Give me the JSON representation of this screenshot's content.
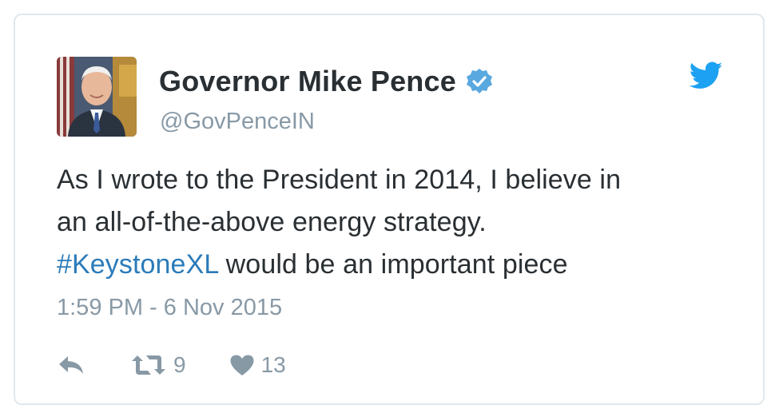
{
  "tweet": {
    "author": {
      "display_name": "Governor Mike Pence",
      "handle": "@GovPenceIN",
      "verified": true,
      "avatar_icon": "profile-photo"
    },
    "text": {
      "line1": "As I wrote to the President in 2014, I believe in",
      "line2": "an all-of-the-above energy strategy.",
      "hashtag": "#KeystoneXL",
      "line3_rest": " would be an important piece"
    },
    "timestamp": "1:59 PM - 6 Nov 2015",
    "actions": {
      "reply_icon": "reply-icon",
      "retweet_icon": "retweet-icon",
      "retweet_count": "9",
      "like_icon": "heart-icon",
      "like_count": "13"
    },
    "brand_icon": "twitter-bird-icon"
  },
  "colors": {
    "link": "#2b7bb9",
    "secondary_text": "#8899a6",
    "primary_text": "#292f33",
    "brand_blue": "#1da1f2",
    "border": "#e1e8ed"
  }
}
